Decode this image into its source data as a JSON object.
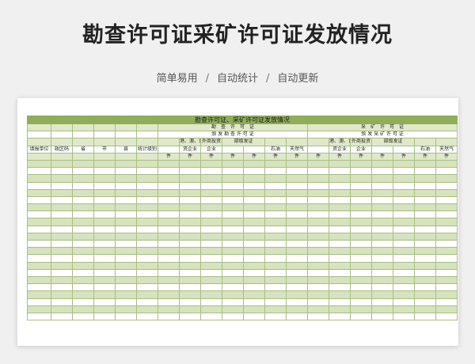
{
  "page": {
    "title": "勘查许可证采矿许可证发放情况",
    "subtitle_items": [
      "简单易用",
      "自动统计",
      "自动更新"
    ],
    "subtitle_sep": "/"
  },
  "sheet": {
    "title": "勘查许可证、采矿许可证发放情况",
    "row2": {
      "explore": "勘　查　许　可　证",
      "mining": "采　矿　许　可　证"
    },
    "row3": {
      "explore": "颁 发 勘 查 许 可 证",
      "mining": "颁 发 采 矿 许 可 证"
    },
    "row4": {
      "explore_hmt": "港、澳、台商投",
      "explore_foreign": "外商投资",
      "explore_ministry": "部级发证",
      "mining_hmt": "港、澳、台商投",
      "mining_foreign": "外商投资",
      "mining_ministry": "部级发证"
    },
    "row5": {
      "unit": "填报单位",
      "region": "政区码",
      "province": "省",
      "city": "市",
      "county": "县",
      "level": "统计级别",
      "explore_fund": "资企业",
      "explore_ent": "企业",
      "explore_oil": "石油",
      "explore_gas": "天然气",
      "mining_fund": "资企业",
      "mining_ent": "企业",
      "mining_oil": "石油",
      "mining_gas": "天然气"
    },
    "row6_unit": "件",
    "body_row_count": 22
  }
}
